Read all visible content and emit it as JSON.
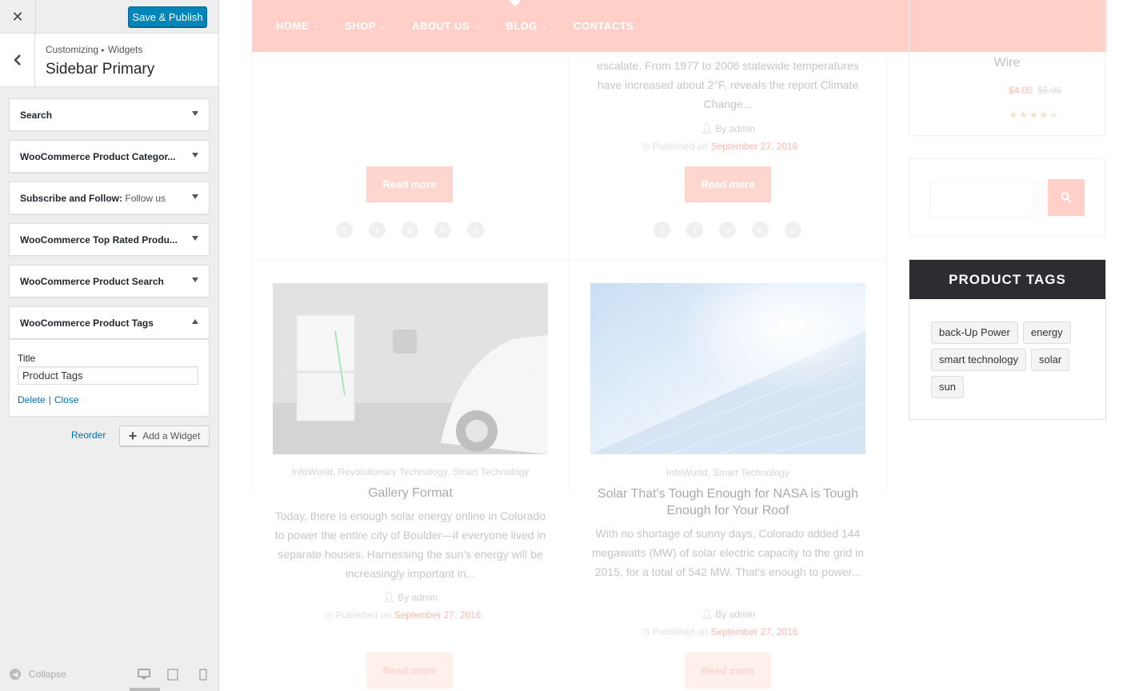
{
  "customizer": {
    "close_icon": "✕",
    "publish_label": "Save & Publish",
    "breadcrumb": {
      "root": "Customizing",
      "separator": "▸",
      "child": "Widgets"
    },
    "section_title": "Sidebar Primary",
    "widgets": [
      {
        "title": "Search",
        "subtitle": "",
        "expanded": false
      },
      {
        "title": "WooCommerce Product Categor...",
        "subtitle": "",
        "expanded": false
      },
      {
        "title": "Subscribe and Follow:",
        "subtitle": "Follow us",
        "expanded": false
      },
      {
        "title": "WooCommerce Top Rated Produ...",
        "subtitle": "",
        "expanded": false
      },
      {
        "title": "WooCommerce Product Search",
        "subtitle": "",
        "expanded": false
      },
      {
        "title": "WooCommerce Product Tags",
        "subtitle": "",
        "expanded": true
      }
    ],
    "tags_form": {
      "title_label": "Title",
      "title_value": "Product Tags",
      "delete_label": "Delete",
      "link_separator": "|",
      "close_label": "Close"
    },
    "reorder_label": "Reorder",
    "add_widget_label": "Add a Widget",
    "collapse_label": "Collapse"
  },
  "preview": {
    "nav": [
      "HOME",
      "SHOP",
      "ABOUT US",
      "BLOG",
      "CONTACTS"
    ],
    "nav_has_dropdown": [
      true,
      true,
      true,
      true,
      false
    ],
    "top_post": {
      "excerpt": "escalate. From 1977 to 2006 statewide temperatures have increased about 2°F, reveals the report Climate Change...",
      "author": "By admin",
      "published_prefix": "Published on",
      "date": "September 27, 2016"
    },
    "read_more": "Read more",
    "posts": [
      {
        "category": "InfoWorld, Revolutionary Technology, Smart Technology",
        "title": "Gallery Format",
        "excerpt": "Today, there is enough solar energy online in Colorado to power the entire city of Boulder—if everyone lived in separate houses. Harnessing the sun's energy will be increasingly important in...",
        "author": "By admin",
        "published_prefix": "Published on",
        "date": "September 27, 2016"
      },
      {
        "category": "InfoWorld, Smart Technology",
        "title": "Solar That's Tough Enough for NASA is Tough Enough for Your Roof",
        "excerpt": "With no shortage of sunny days, Colorado added 144 megawatts (MW) of solar electric capacity to the grid in 2015, for a total of 542 MW. That's enough to power...",
        "author": "By admin",
        "published_prefix": "Published on",
        "date": "September 27, 2016"
      }
    ],
    "sidebar": {
      "product_name": "Wire",
      "price": "$4.00",
      "old_price": "$6.00",
      "rating": 4,
      "rating_max": 5,
      "tags_title": "PRODUCT TAGS",
      "tags": [
        "back-Up Power",
        "energy",
        "smart technology",
        "solar",
        "sun"
      ]
    }
  }
}
